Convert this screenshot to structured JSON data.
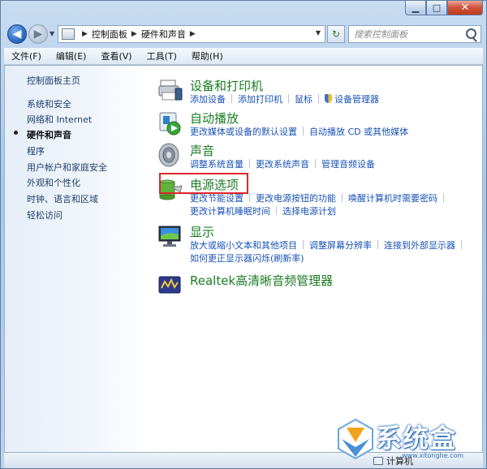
{
  "search": {
    "placeholder": "搜索控制面板"
  },
  "breadcrumb": {
    "root": "控制面板",
    "current": "硬件和声音"
  },
  "menu": [
    "文件(F)",
    "编辑(E)",
    "查看(V)",
    "工具(T)",
    "帮助(H)"
  ],
  "left_nav": {
    "home": "控制面板主页",
    "items": [
      "系统和安全",
      "网络和 Internet",
      "硬件和声音",
      "程序",
      "用户帐户和家庭安全",
      "外观和个性化",
      "时钟、语言和区域",
      "轻松访问"
    ],
    "current_index": 2
  },
  "categories": [
    {
      "title": "设备和打印机",
      "icon": "printer-icon",
      "task_lines": [
        [
          "添加设备",
          "添加打印机",
          "鼠标",
          "设备管理器"
        ]
      ]
    },
    {
      "title": "自动播放",
      "icon": "autoplay-icon",
      "task_lines": [
        [
          "更改媒体或设备的默认设置",
          "自动播放 CD 或其他媒体"
        ]
      ]
    },
    {
      "title": "声音",
      "icon": "speaker-icon",
      "task_lines": [
        [
          "调整系统音量",
          "更改系统声音",
          "管理音频设备"
        ]
      ]
    },
    {
      "title": "电源选项",
      "icon": "battery-icon",
      "task_lines": [
        [
          "更改节能设置",
          "更改电源按钮的功能",
          "唤醒计算机时需要密码"
        ],
        [
          "更改计算机睡眠时间",
          "选择电源计划"
        ]
      ]
    },
    {
      "title": "显示",
      "icon": "monitor-icon",
      "task_lines": [
        [
          "放大或缩小文本和其他项目",
          "调整屏幕分辨率",
          "连接到外部显示器"
        ],
        [
          "如何更正显示器闪烁(刷新率)"
        ]
      ]
    },
    {
      "title": "Realtek高清晰音频管理器",
      "icon": "realtek-audio-icon",
      "task_lines": []
    }
  ],
  "statusbar": {
    "text": "计算机"
  },
  "watermark": {
    "text": "系统盒",
    "url": "www.xitonghe.com"
  },
  "colors": {
    "link_blue": "#1851b6",
    "category_green": "#1b7c24",
    "highlight_red": "#e0262a"
  }
}
